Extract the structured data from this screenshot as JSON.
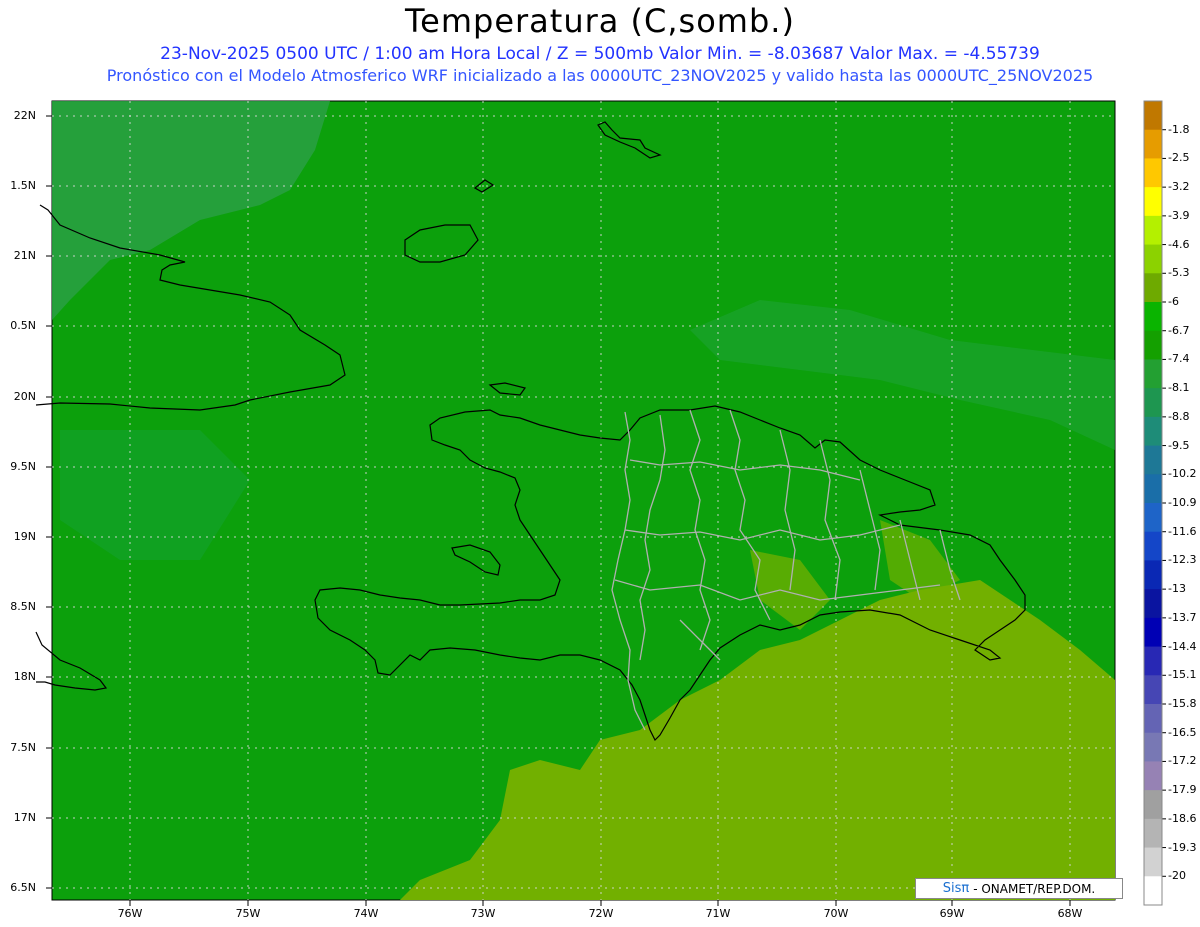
{
  "header": {
    "title": "Temperatura (C,somb.)",
    "subtitle1": "23-Nov-2025  0500 UTC / 1:00 am Hora Local / Z = 500mb  Valor Min. = -8.03687  Valor Max. = -4.55739",
    "subtitle2": "Pronóstico con el Modelo Atmosferico WRF inicializado a las 0000UTC_23NOV2025 y valido hasta las  0000UTC_25NOV2025"
  },
  "axes": {
    "lat_labels": [
      "22N",
      "1.5N",
      "21N",
      "0.5N",
      "20N",
      "9.5N",
      "19N",
      "8.5N",
      "18N",
      "7.5N",
      "17N",
      "6.5N"
    ],
    "lon_labels": [
      "76W",
      "75W",
      "74W",
      "73W",
      "72W",
      "71W",
      "70W",
      "69W",
      "68W"
    ]
  },
  "colorbar": {
    "labels": [
      "-1.8",
      "-2.5",
      "-3.2",
      "-3.9",
      "-4.6",
      "-5.3",
      "-6",
      "-6.7",
      "-7.4",
      "-8.1",
      "-8.8",
      "-9.5",
      "-10.2",
      "-10.9",
      "-11.6",
      "-12.3",
      "-13",
      "-13.7",
      "-14.4",
      "-15.1",
      "-15.8",
      "-16.5",
      "-17.2",
      "-17.9",
      "-18.6",
      "-19.3",
      "-20"
    ],
    "colors": [
      "#c07800",
      "#e69c00",
      "#ffc800",
      "#ffff00",
      "#b4f000",
      "#8cd200",
      "#6eaa00",
      "#0ab400",
      "#14a000",
      "#23a032",
      "#1e9650",
      "#1e8c78",
      "#1e7896",
      "#1a6ea8",
      "#1e64c8",
      "#1446c8",
      "#0a28b4",
      "#0a14a0",
      "#0000b4",
      "#2828b4",
      "#4646b4",
      "#6464b4",
      "#7878b4",
      "#9682b4",
      "#a0a0a0",
      "#b4b4b4",
      "#d2d2d2",
      "#ffffff"
    ]
  },
  "field_colors": {
    "main": "#0ca00c",
    "warm": "#72b000",
    "cool": "#2aa044",
    "coast": "#000000",
    "border": "#b0b0b0"
  },
  "credit": {
    "sis": "Sisπ",
    "text": "- ONAMET/REP.DOM."
  }
}
